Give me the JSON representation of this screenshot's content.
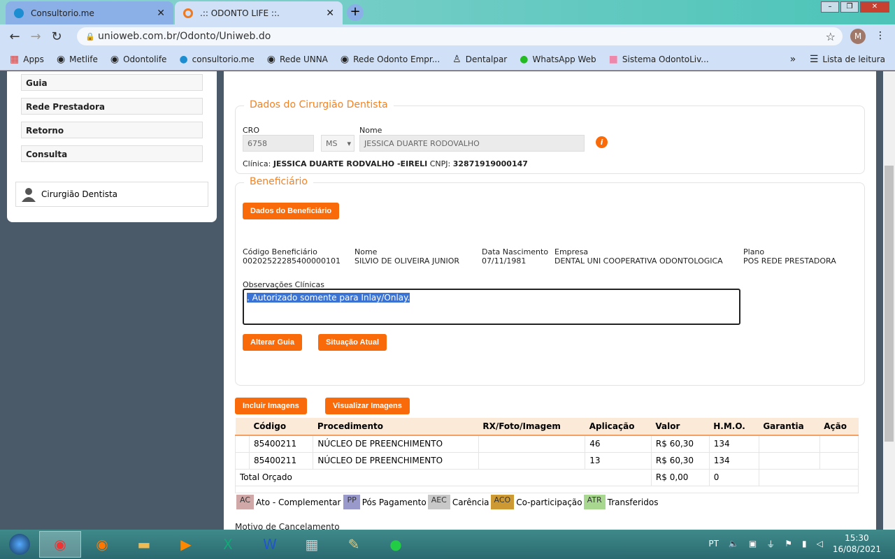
{
  "browser": {
    "tabs": [
      {
        "title": "Consultorio.me"
      },
      {
        "title": ".:: ODONTO LIFE ::."
      }
    ],
    "url": "unioweb.com.br/Odonto/Uniweb.do",
    "profile_initial": "M",
    "bookmarks": [
      "Apps",
      "Metlife",
      "Odontolife",
      "consultorio.me",
      "Rede UNNA",
      "Rede Odonto Empr...",
      "Dentalpar",
      "WhatsApp Web",
      "Sistema OdontoLiv..."
    ],
    "reading_list": "Lista de leitura"
  },
  "sidebar": {
    "items": [
      "Guia",
      "Rede Prestadora",
      "Retorno",
      "Consulta"
    ],
    "dentist_link": "Cirurgião Dentista"
  },
  "dentist": {
    "legend": "Dados do Cirurgião Dentista",
    "cro_label": "CRO",
    "cro": "6758",
    "uf": "MS",
    "name_label": "Nome",
    "name": "JESSICA DUARTE RODOVALHO",
    "clinic_label": "Clínica:",
    "clinic": "JESSICA DUARTE RODVALHO -EIRELI",
    "cnpj_label": "CNPJ:",
    "cnpj": "32871919000147"
  },
  "beneficiary": {
    "legend": "Beneficiário",
    "data_button": "Dados do Beneficiário",
    "fields": [
      {
        "label": "Código Beneficiário",
        "value": "00202522285400000101"
      },
      {
        "label": "Nome",
        "value": "SILVIO DE OLIVEIRA JUNIOR"
      },
      {
        "label": "Data Nascimento",
        "value": "07/11/1981"
      },
      {
        "label": "Empresa",
        "value": "DENTAL UNI COOPERATIVA ODONTOLOGICA"
      },
      {
        "label": "Plano",
        "value": "POS REDE PRESTADORA"
      }
    ],
    "obs_label": "Observações Clínicas",
    "obs": ". Autorizado somente para Inlay/Onlay.",
    "alter_button": "Alterar Guia",
    "status_button": "Situação Atual"
  },
  "images": {
    "include": "Incluir Imagens",
    "view": "Visualizar Imagens"
  },
  "table": {
    "headers": [
      "Código",
      "Procedimento",
      "RX/Foto/Imagem",
      "Aplicação",
      "Valor",
      "H.M.O.",
      "Garantia",
      "Ação"
    ],
    "rows": [
      [
        "85400211",
        "NÚCLEO DE PREENCHIMENTO",
        "",
        "46",
        "R$ 60,30",
        "134",
        "",
        ""
      ],
      [
        "85400211",
        "NÚCLEO DE PREENCHIMENTO",
        "",
        "13",
        "R$ 60,30",
        "134",
        "",
        ""
      ]
    ],
    "total_label": "Total Orçado",
    "total_value": "R$ 0,00",
    "total_hmo": "0"
  },
  "legend_items": [
    {
      "code": "AC",
      "label": "Ato - Complementar",
      "color": "#d0a8a8"
    },
    {
      "code": "PP",
      "label": "Pós Pagamento",
      "color": "#9999cc"
    },
    {
      "code": "AEC",
      "label": "Carência",
      "color": "#c8c8c8"
    },
    {
      "code": "ACO",
      "label": "Co-participação",
      "color": "#cc9933"
    },
    {
      "code": "ATR",
      "label": "Transferidos",
      "color": "#a8d890"
    }
  ],
  "cancel_label": "Motivo de Cancelamento",
  "taskbar": {
    "lang": "PT",
    "time": "15:30",
    "date": "16/08/2021"
  }
}
